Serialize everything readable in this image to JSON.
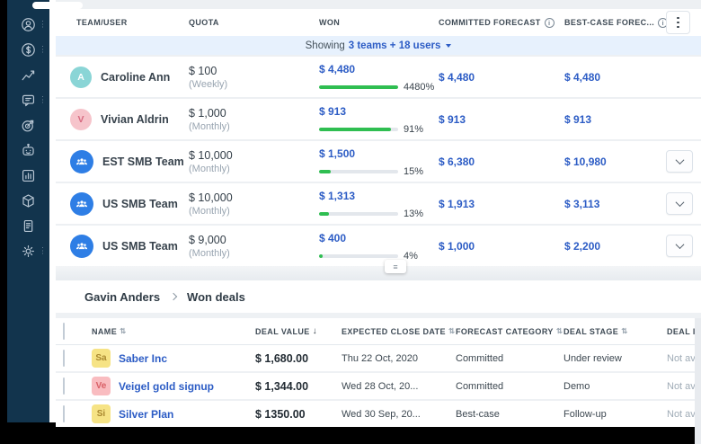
{
  "colors": {
    "sidebar_bg": "#12344d",
    "accent_blue": "#2c5cc5",
    "progress_green": "#2fbe51",
    "banner_bg": "#e7f1fd",
    "team_avatar_bg": "#2e7ee5"
  },
  "sidebar": {
    "icons": [
      "user-icon",
      "dollar-icon",
      "trend-chart-icon",
      "chat-icon",
      "target-icon",
      "bot-icon",
      "bar-chart-icon",
      "cube-icon",
      "document-icon",
      "settings-icon"
    ]
  },
  "forecast": {
    "columns": [
      "TEAM/USER",
      "QUOTA",
      "WON",
      "COMMITTED FORECAST",
      "BEST-CASE FOREC..."
    ],
    "banner": {
      "prefix": "Showing",
      "link": "3 teams + 18 users"
    },
    "rows": [
      {
        "name": "Caroline Ann",
        "initial": "A",
        "avatar_bg": "#8ad5d6",
        "avatar_fg": "#ffffff",
        "quota": "$ 100",
        "period": "(Weekly)",
        "won": "$ 4,480",
        "pct": 4480,
        "pct_label": "4480%",
        "committed": "$ 4,480",
        "best_case": "$ 4,480"
      },
      {
        "name": "Vivian Aldrin",
        "initial": "V",
        "avatar_bg": "#f6c4cb",
        "avatar_fg": "#d76a80",
        "quota": "$ 1,000",
        "period": "(Monthly)",
        "won": "$ 913",
        "pct": 91,
        "pct_label": "91%",
        "committed": "$ 913",
        "best_case": "$ 913"
      },
      {
        "name": "EST SMB Team",
        "quota": "$ 10,000",
        "period": "(Monthly)",
        "won": "$ 1,500",
        "pct": 15,
        "pct_label": "15%",
        "committed": "$ 6,380",
        "best_case": "$ 10,980"
      },
      {
        "name": "US SMB Team",
        "quota": "$ 10,000",
        "period": "(Monthly)",
        "won": "$ 1,313",
        "pct": 13,
        "pct_label": "13%",
        "committed": "$ 1,913",
        "best_case": "$ 3,113"
      },
      {
        "name": "US SMB Team",
        "quota": "$ 9,000",
        "period": "(Monthly)",
        "won": "$ 400",
        "pct": 4,
        "pct_label": "4%",
        "committed": "$ 1,000",
        "best_case": "$ 2,200"
      }
    ]
  },
  "deals": {
    "breadcrumb": {
      "parent": "Gavin Anders",
      "current": "Won deals"
    },
    "columns": [
      "NAME",
      "DEAL VALUE",
      "EXPECTED CLOSE DATE",
      "FORECAST CATEGORY",
      "DEAL STAGE",
      "DEAL INSIG"
    ],
    "rows": [
      {
        "initials": "Sa",
        "avatar_bg": "#f6e385",
        "avatar_fg": "#a8872f",
        "name": "Saber Inc",
        "value": "$ 1,680.00",
        "close_date": "Thu 22 Oct, 2020",
        "category": "Committed",
        "stage": "Under review",
        "insight": "Not availab"
      },
      {
        "initials": "Ve",
        "avatar_bg": "#f9bcc0",
        "avatar_fg": "#d95f66",
        "name": "Veigel gold signup",
        "value": "$ 1,344.00",
        "close_date": "Wed 28 Oct, 20...",
        "category": "Committed",
        "stage": "Demo",
        "insight": "Not availab"
      },
      {
        "initials": "Si",
        "avatar_bg": "#f6e385",
        "avatar_fg": "#a8872f",
        "name": "Silver Plan",
        "value": "$ 1350.00",
        "close_date": "Wed 30 Sep, 20...",
        "category": "Best-case",
        "stage": "Follow-up",
        "insight": "Not availab"
      }
    ]
  }
}
